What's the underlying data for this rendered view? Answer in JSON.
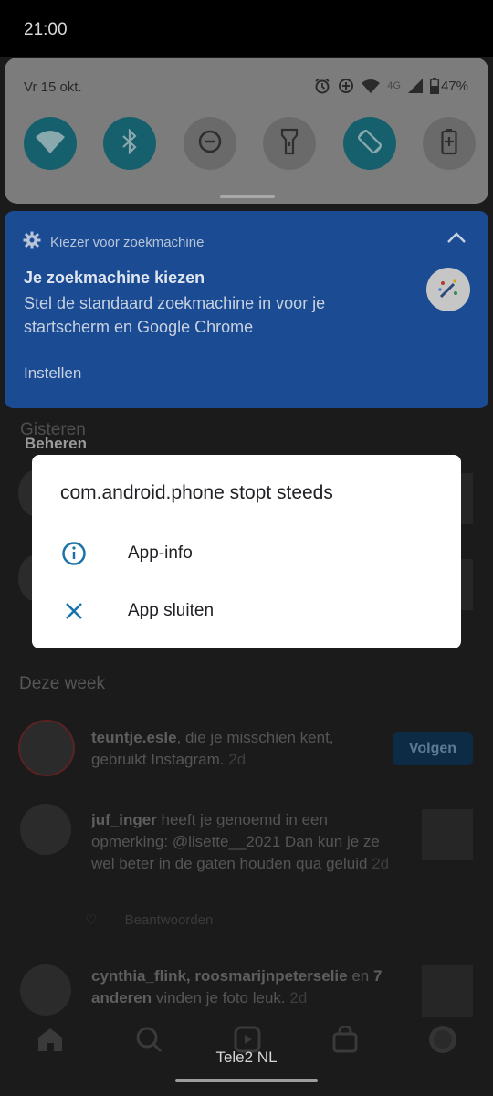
{
  "status_bar": {
    "time": "21:00"
  },
  "quick_settings": {
    "date": "Vr 15 okt.",
    "network": "4G",
    "battery": "47%",
    "tiles": [
      {
        "name": "wifi-tile",
        "icon": "wifi-icon",
        "on": true
      },
      {
        "name": "bluetooth-tile",
        "icon": "bluetooth-icon",
        "on": true
      },
      {
        "name": "do-not-disturb-tile",
        "icon": "minus-circle-icon",
        "on": false
      },
      {
        "name": "flashlight-tile",
        "icon": "flashlight-icon",
        "on": false
      },
      {
        "name": "auto-rotate-tile",
        "icon": "rotate-icon",
        "on": true
      },
      {
        "name": "battery-saver-tile",
        "icon": "battery-saver-icon",
        "on": false
      }
    ]
  },
  "notification": {
    "app_label": "Kiezer voor zoekmachine",
    "title": "Je zoekmachine kiezen",
    "body": "Stel de standaard zoekmachine in voor je startscherm en Google Chrome",
    "action": "Instellen"
  },
  "background": {
    "beheren": "Beheren",
    "gisteren": "Gisteren",
    "deze_week": "Deze week",
    "row1": {
      "user": "teuntje.esle",
      "text": ", die je misschien kent, gebruikt Instagram.",
      "time": "2d",
      "follow": "Volgen"
    },
    "row2": {
      "user": "juf_inger",
      "text": " heeft je genoemd in een opmerking: @lisette__2021 Dan kun je ze wel beter in de gaten houden qua geluid",
      "time": "2d",
      "reply": "Beantwoorden"
    },
    "row3": {
      "user": "cynthia_flink, roosmarijnpeterselie",
      "mid": " en ",
      "user2": "7 anderen",
      "text": " vinden je foto leuk.",
      "time": "2d"
    }
  },
  "dialog": {
    "title": "com.android.phone stopt steeds",
    "items": [
      {
        "label": "App-info",
        "icon": "info-icon"
      },
      {
        "label": "App sluiten",
        "icon": "close-icon"
      }
    ]
  },
  "carrier": "Tele2 NL",
  "colors": {
    "accent": "#1a73a8",
    "tile_on": "#16606d",
    "notification_bg": "#1a4b93",
    "dialog_bg": "#ffffff"
  }
}
